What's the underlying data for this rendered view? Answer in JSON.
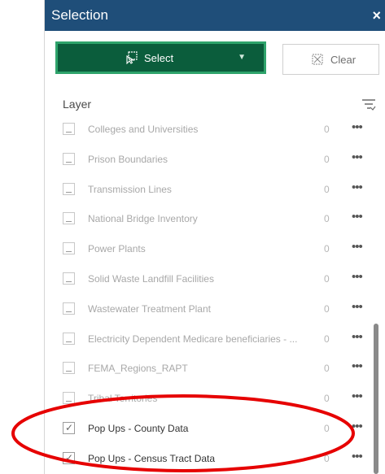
{
  "panel": {
    "title": "Selection",
    "close_glyph": "×"
  },
  "toolbar": {
    "select_label": "Select",
    "clear_label": "Clear"
  },
  "layer_header": {
    "label": "Layer"
  },
  "layers": [
    {
      "name": "Colleges and Universities",
      "count": "0",
      "checked": false
    },
    {
      "name": "Prison Boundaries",
      "count": "0",
      "checked": false
    },
    {
      "name": "Transmission Lines",
      "count": "0",
      "checked": false
    },
    {
      "name": "National Bridge Inventory",
      "count": "0",
      "checked": false
    },
    {
      "name": "Power Plants",
      "count": "0",
      "checked": false
    },
    {
      "name": "Solid Waste Landfill Facilities",
      "count": "0",
      "checked": false
    },
    {
      "name": "Wastewater Treatment Plant",
      "count": "0",
      "checked": false
    },
    {
      "name": "Electricity Dependent Medicare beneficiaries - ...",
      "count": "0",
      "checked": false
    },
    {
      "name": "FEMA_Regions_RAPT",
      "count": "0",
      "checked": false
    },
    {
      "name": "Tribal Territories",
      "count": "0",
      "checked": false
    },
    {
      "name": "Pop Ups - County Data",
      "count": "0",
      "checked": true
    },
    {
      "name": "Pop Ups - Census Tract Data",
      "count": "0",
      "checked": true
    }
  ],
  "more_glyph": "•••",
  "colors": {
    "header": "#1f4e79",
    "select_bg": "#0b5d3c",
    "select_border": "#2ea36b",
    "annotation": "#e60000"
  },
  "icons": {
    "select": "select-rectangle-icon",
    "clear": "clear-selection-icon",
    "filter": "filter-icon",
    "close": "close-icon"
  }
}
